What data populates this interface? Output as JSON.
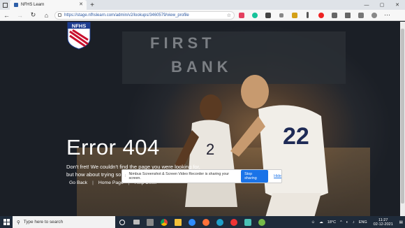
{
  "browser": {
    "tab_title": "NFHS Learn",
    "tab_close": "✕",
    "new_tab": "+",
    "url": "https://stage.nfhslearn.com/admin/v2/lookups/3460579/view_profile",
    "minimize": "—",
    "maximize": "▢",
    "close": "✕",
    "back": "←",
    "forward": "→",
    "refresh": "↻",
    "home": "⌂",
    "star": "☆",
    "menu": "⋯"
  },
  "logo": {
    "text": "NFHS"
  },
  "banner": {
    "line1": "FIRST",
    "line2": "BANK"
  },
  "error": {
    "title": "Error 404",
    "message": "Don't fret! We couldn't find the page you were looking for, but how about trying some of these options?",
    "links": [
      "Go Back",
      "Home Page",
      "Help Desk"
    ],
    "separator": "|"
  },
  "share_bar": {
    "grip": "⁞",
    "text": "Nimbus Screenshot & Screen Video Recorder is sharing your screen.",
    "stop_label": "Stop sharing",
    "hide_label": "Hide"
  },
  "taskbar": {
    "search_placeholder": "Type here to search",
    "weather": "18°C",
    "time": "11:27",
    "date": "02-12-2021",
    "lang": "ENG"
  },
  "colors": {
    "accent": "#1a73e8",
    "logo_red": "#c8102e",
    "logo_blue": "#1d3c8f"
  }
}
